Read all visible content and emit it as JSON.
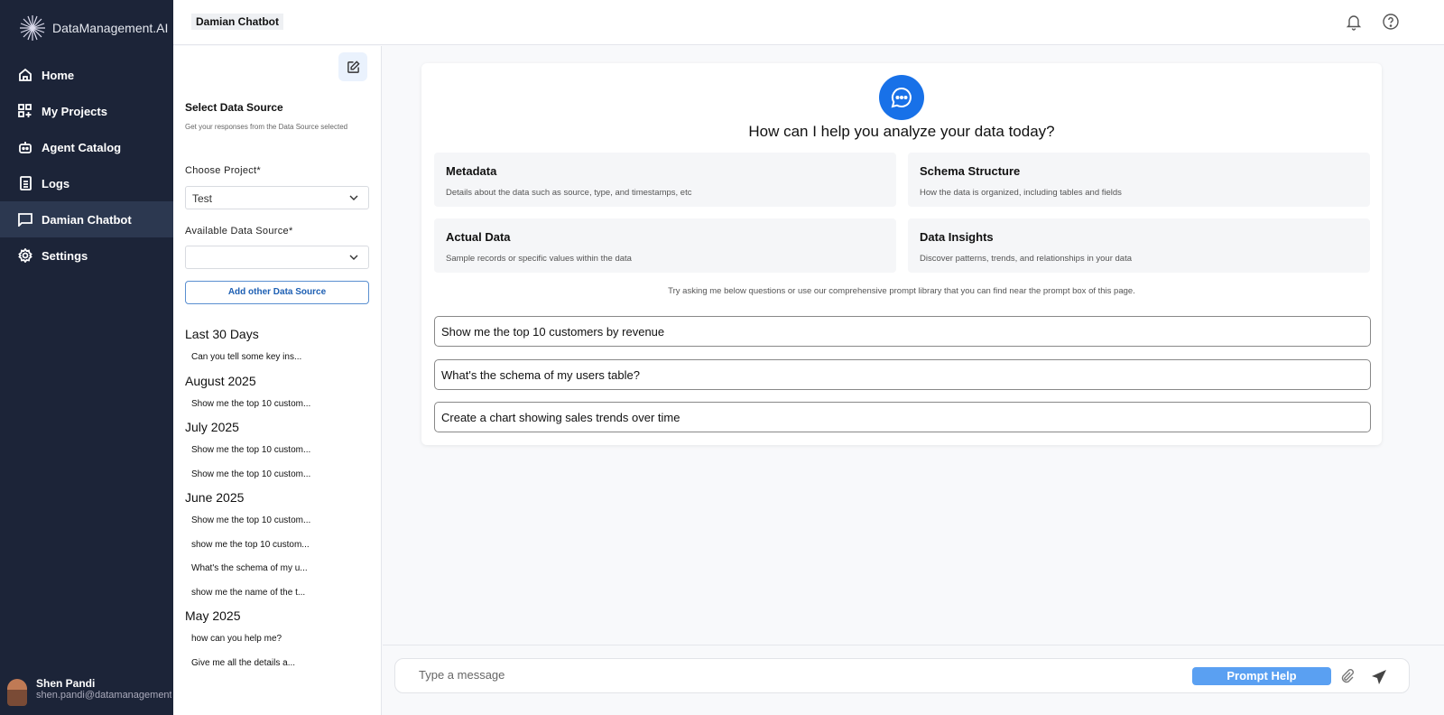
{
  "brand": "DataManagement.AI",
  "nav": [
    {
      "label": "Home",
      "icon": "home-icon"
    },
    {
      "label": "My Projects",
      "icon": "projects-icon"
    },
    {
      "label": "Agent Catalog",
      "icon": "robot-icon"
    },
    {
      "label": "Logs",
      "icon": "logs-icon"
    },
    {
      "label": "Damian Chatbot",
      "icon": "chat-icon",
      "active": true
    },
    {
      "label": "Settings",
      "icon": "gear-icon"
    }
  ],
  "user": {
    "name": "Shen Pandi",
    "email": "shen.pandi@datamanagement.ai"
  },
  "header": {
    "title": "Damian Chatbot"
  },
  "panel": {
    "title": "Select Data Source",
    "subtitle": "Get your responses from the Data Source selected",
    "project_label": "Choose Project*",
    "project_value": "Test",
    "source_label": "Available Data Source*",
    "source_value": "",
    "add_source": "Add other Data Source",
    "history": [
      {
        "heading": "Last 30 Days",
        "items": [
          "Can you tell some key ins..."
        ]
      },
      {
        "heading": "August 2025",
        "items": [
          "Show me the top 10 custom..."
        ]
      },
      {
        "heading": "July 2025",
        "items": [
          "Show me the top 10 custom...",
          "Show me the top 10 custom..."
        ]
      },
      {
        "heading": "June 2025",
        "items": [
          "Show me the top 10 custom...",
          "show me the top 10 custom...",
          "What's the schema of my u...",
          "show me the name of the t..."
        ]
      },
      {
        "heading": "May 2025",
        "items": [
          "how can you help me?",
          "Give me all the details a..."
        ]
      }
    ]
  },
  "main": {
    "title": "How can I help you analyze your data today?",
    "tiles": [
      {
        "title": "Metadata",
        "desc": "Details about the data such as source, type, and timestamps, etc"
      },
      {
        "title": "Schema Structure",
        "desc": "How the data is organized, including tables and fields"
      },
      {
        "title": "Actual Data",
        "desc": "Sample records or specific values within the data"
      },
      {
        "title": "Data Insights",
        "desc": "Discover patterns, trends, and relationships in your data"
      }
    ],
    "hint": "Try asking me below questions or use our comprehensive prompt library that you can find near the prompt box of this page.",
    "suggestions": [
      "Show me the top 10 customers by revenue",
      "What's the schema of my users table?",
      "Create a chart showing sales trends over time"
    ]
  },
  "composer": {
    "placeholder": "Type a message",
    "prompt_help": "Prompt Help"
  },
  "colors": {
    "sidebar": "#1c2438",
    "accent": "#1871e8",
    "prompt_help": "#5aa0f2"
  }
}
